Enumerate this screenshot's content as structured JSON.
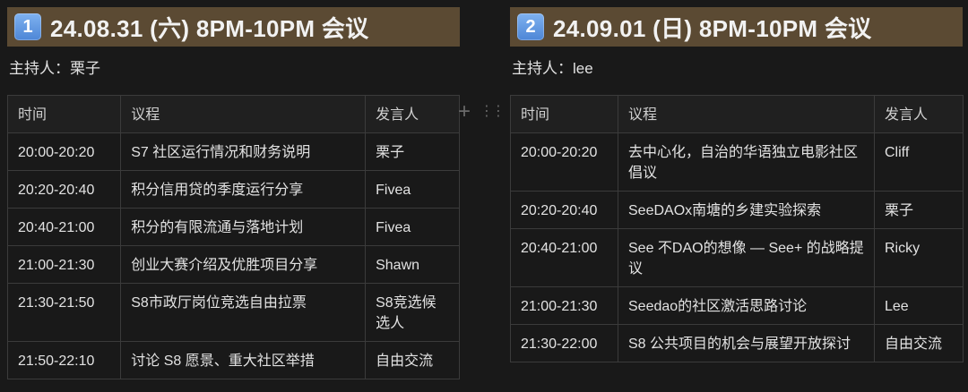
{
  "left": {
    "badge": "1",
    "title": "24.08.31 (六) 8PM-10PM 会议",
    "host": "主持人：栗子",
    "columns": [
      "时间",
      "议程",
      "发言人"
    ],
    "rows": [
      {
        "time": "20:00-20:20",
        "agenda": "S7 社区运行情况和财务说明",
        "speaker": "栗子"
      },
      {
        "time": "20:20-20:40",
        "agenda": "积分信用贷的季度运行分享",
        "speaker": "Fivea"
      },
      {
        "time": "20:40-21:00",
        "agenda": "积分的有限流通与落地计划",
        "speaker": "Fivea"
      },
      {
        "time": "21:00-21:30",
        "agenda": "创业大赛介绍及优胜项目分享",
        "speaker": "Shawn"
      },
      {
        "time": "21:30-21:50",
        "agenda": "S8市政厅岗位竞选自由拉票",
        "speaker": "S8竞选候选人"
      },
      {
        "time": "21:50-22:10",
        "agenda": "讨论 S8 愿景、重大社区举措",
        "speaker": "自由交流"
      }
    ]
  },
  "right": {
    "badge": "2",
    "title": "24.09.01 (日) 8PM-10PM 会议",
    "host": "主持人：lee",
    "columns": [
      "时间",
      "议程",
      "发言人"
    ],
    "rows": [
      {
        "time": "20:00-20:20",
        "agenda": "去中心化，自治的华语独立电影社区倡议",
        "speaker": "Cliff"
      },
      {
        "time": "20:20-20:40",
        "agenda": "SeeDAOx南塘的乡建实验探索",
        "speaker": "栗子"
      },
      {
        "time": "20:40-21:00",
        "agenda": "See 不DAO的想像 — See+ 的战略提议",
        "speaker": "Ricky"
      },
      {
        "time": "21:00-21:30",
        "agenda": "Seedao的社区激活思路讨论",
        "speaker": "Lee"
      },
      {
        "time": "21:30-22:00",
        "agenda": "S8 公共项目的机会与展望开放探讨",
        "speaker": "自由交流"
      }
    ]
  },
  "controls": {
    "add_symbol": "+",
    "drag_symbol": "⋮⋮"
  }
}
